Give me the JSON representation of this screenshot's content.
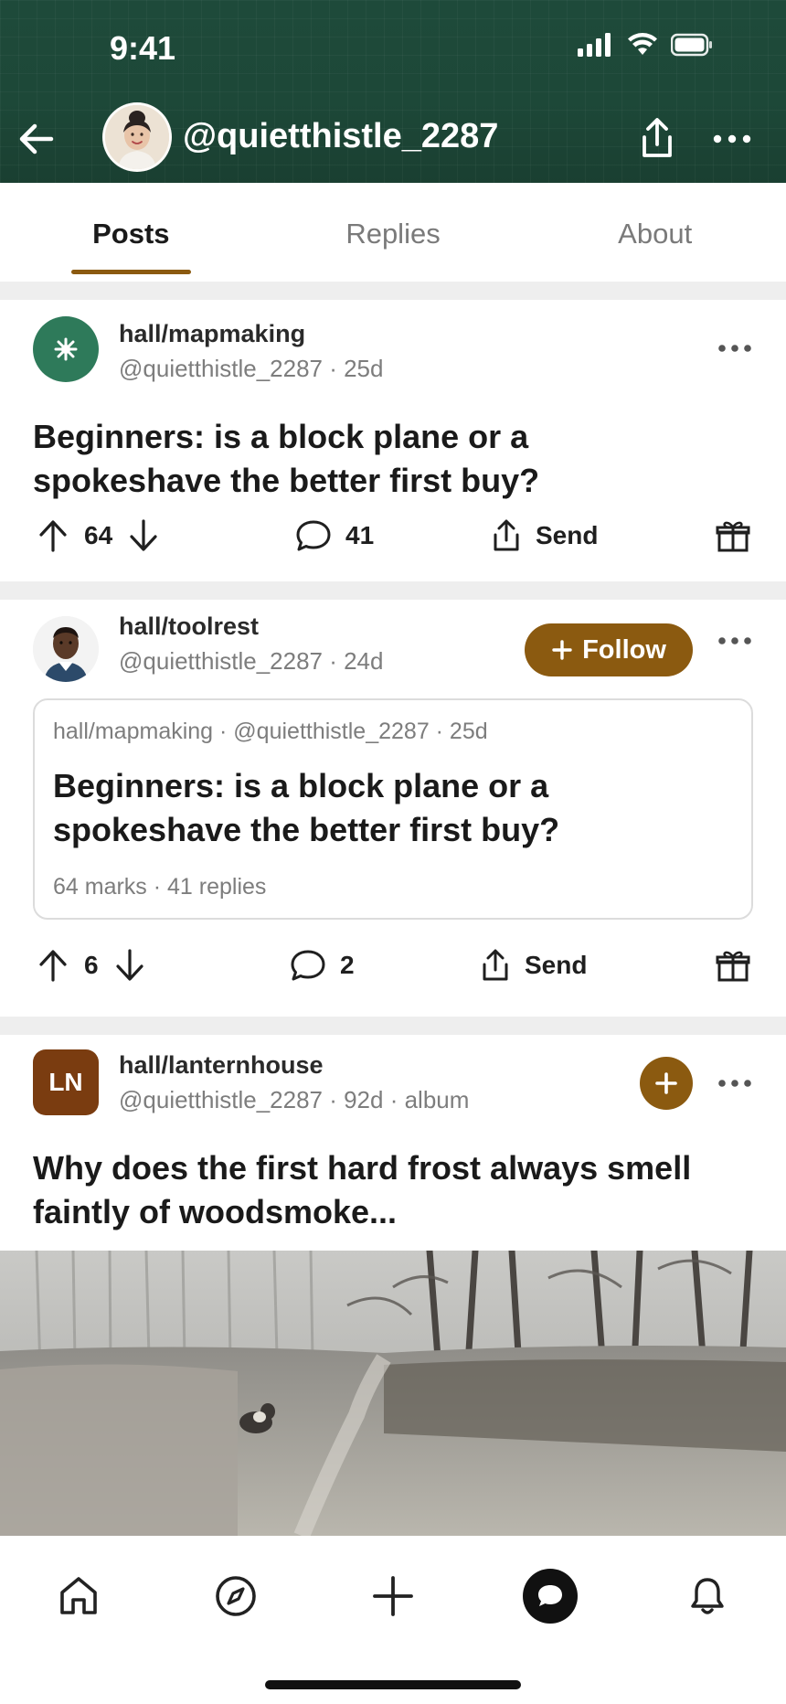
{
  "status_bar": {
    "time": "9:41"
  },
  "header": {
    "handle": "@quietthistle_2287"
  },
  "tabs": [
    {
      "label": "Posts",
      "active": true
    },
    {
      "label": "Replies",
      "active": false
    },
    {
      "label": "About",
      "active": false
    }
  ],
  "posts": [
    {
      "community": "hall/mapmaking",
      "meta": "@quietthistle_2287 · 25d",
      "title": "Beginners: is a block plane or a spokeshave the better first buy?",
      "votes": "64",
      "comments": "41",
      "send_label": "Send"
    },
    {
      "community": "hall/toolrest",
      "meta": "@quietthistle_2287 · 24d",
      "follow_label": "Follow",
      "embed": {
        "meta": "hall/mapmaking · @quietthistle_2287 · 25d",
        "title": "Beginners: is a block plane or a spokeshave the better first buy?",
        "stats": "64 marks · 41 replies"
      },
      "votes": "6",
      "comments": "2",
      "send_label": "Send"
    },
    {
      "community": "hall/lanternhouse",
      "avatar_initials": "LN",
      "meta": "@quietthistle_2287 · 92d · album",
      "title": "Why does the first hard frost always smell faintly of woodsmoke..."
    }
  ],
  "colors": {
    "header_bg": "#1e4a3a",
    "accent": "#8b5a10",
    "community_icon": "#2e7a5a"
  },
  "bottom_nav": [
    "home-icon",
    "explore-icon",
    "create-icon",
    "chat-icon",
    "notifications-icon"
  ]
}
